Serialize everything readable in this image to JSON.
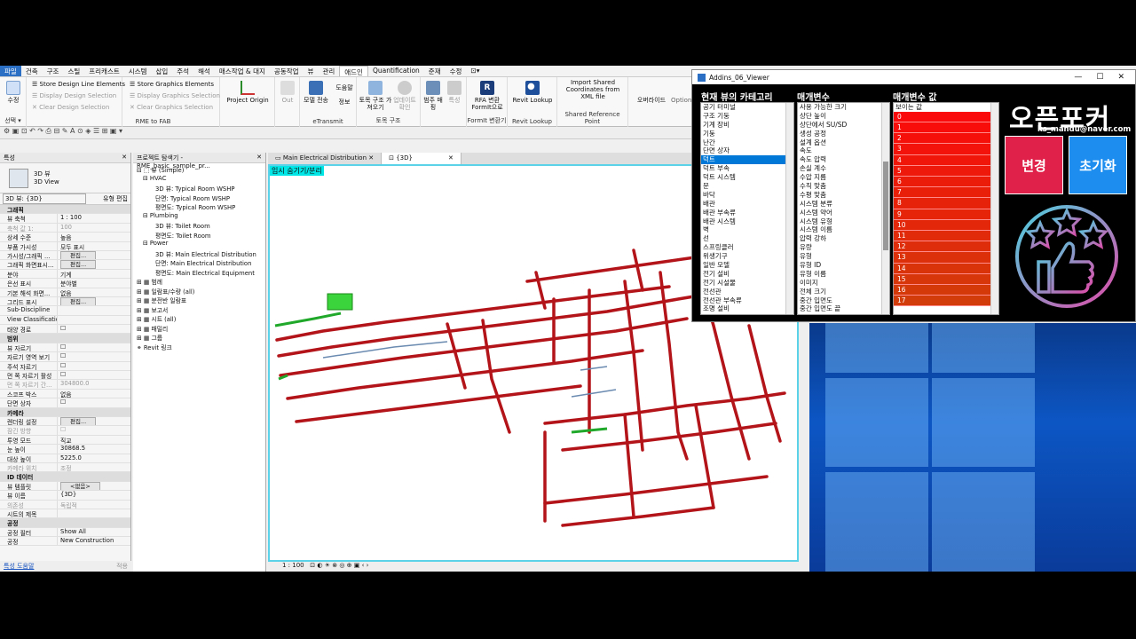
{
  "ribbon": {
    "tabs": [
      "파일",
      "건축",
      "구조",
      "스틸",
      "프리캐스트",
      "시스템",
      "삽입",
      "주석",
      "해석",
      "매스작업 & 대지",
      "공동작업",
      "뷰",
      "관리",
      "애드인",
      "Quantification",
      "준재",
      "수정",
      "⊡▾"
    ],
    "store_line": "Store Design Line Elements",
    "display_design": "Display Design Selection",
    "clear_design": "Clear Design Selection",
    "store_graphics": "Store Graphics Elements",
    "display_graphics": "Display Graphics Selection",
    "clear_graphics": "Clear Graphics Selection",
    "group_rme": "RME to FAB",
    "select_label": "선택 ▾",
    "modify": "수정",
    "project_origin": "Project Origin",
    "out": "Out",
    "model_send": "모델 전송",
    "help": "도움말",
    "info": "정보",
    "etransmit": "eTransmit",
    "civil_import": "토목 구조 가져오기",
    "update_check": "업데이트 확인",
    "range_label": "범주 매핑",
    "attr": "특성",
    "civil_group": "토목 구조",
    "rfa": "RFA 변환 FormIt으로",
    "formit_group": "FormIt 변환기",
    "revit_lookup": "Revit Lookup",
    "lookup_group": "Revit Lookup",
    "import_coords": "Import Shared Coordinates from XML file",
    "shared_ref": "Shared Reference Point",
    "override": "오버라이드",
    "option": "Option"
  },
  "properties": {
    "title": "특성",
    "type_name": "3D 뷰",
    "type_sub": "3D View",
    "selector": "3D 뷰: {3D}",
    "edit_type": "유형 편집",
    "rows": [
      {
        "k": "그래픽",
        "v": "",
        "sec": true
      },
      {
        "k": "뷰 축척",
        "v": "1 : 100"
      },
      {
        "k": "축척 값  1:",
        "v": "100",
        "dim": true
      },
      {
        "k": "상세 수준",
        "v": "높음"
      },
      {
        "k": "부품 가시성",
        "v": "모두 표시"
      },
      {
        "k": "가시성/그래픽 ...",
        "v": "편집...",
        "btn": true
      },
      {
        "k": "그래픽 화면표시...",
        "v": "편집...",
        "btn": true
      },
      {
        "k": "분야",
        "v": "기계"
      },
      {
        "k": "은선 표시",
        "v": "분야별"
      },
      {
        "k": "기본 해석 화면...",
        "v": "없음"
      },
      {
        "k": "그리드 표시",
        "v": "편집...",
        "btn": true
      },
      {
        "k": "Sub-Discipline",
        "v": ""
      },
      {
        "k": "View Classification",
        "v": ""
      },
      {
        "k": "태양 경로",
        "v": "☐"
      },
      {
        "k": "범위",
        "v": "",
        "sec": true
      },
      {
        "k": "뷰 자르기",
        "v": "☐"
      },
      {
        "k": "자르기 영역 보기",
        "v": "☐"
      },
      {
        "k": "주석 자르기",
        "v": "☐"
      },
      {
        "k": "먼 쪽 자르기 활성",
        "v": "☐"
      },
      {
        "k": "먼 쪽 자르기 간...",
        "v": "304800.0",
        "dim": true
      },
      {
        "k": "스코프 박스",
        "v": "없음"
      },
      {
        "k": "단면 상자",
        "v": "☐"
      },
      {
        "k": "카메라",
        "v": "",
        "sec": true
      },
      {
        "k": "렌더링 설정",
        "v": "편집...",
        "btn": true
      },
      {
        "k": "잠긴 방향",
        "v": "☐",
        "dim": true
      },
      {
        "k": "투영 모드",
        "v": "직교"
      },
      {
        "k": "눈 높이",
        "v": "30868.5"
      },
      {
        "k": "대상 높이",
        "v": "5225.0"
      },
      {
        "k": "카메라 위치",
        "v": "조정",
        "dim": true
      },
      {
        "k": "ID 데이터",
        "v": "",
        "sec": true
      },
      {
        "k": "뷰 템플릿",
        "v": "<없음>",
        "btn": true
      },
      {
        "k": "뷰 이름",
        "v": "{3D}"
      },
      {
        "k": "의존성",
        "v": "독립적",
        "dim": true
      },
      {
        "k": "시트의 제목",
        "v": ""
      },
      {
        "k": "공정",
        "v": "",
        "sec": true
      },
      {
        "k": "공정 필터",
        "v": "Show All"
      },
      {
        "k": "공정",
        "v": "New Construction"
      }
    ],
    "help_link": "특성 도움말",
    "apply": "적용"
  },
  "browser": {
    "title": "프로젝트 탐색기 - RME_basic_sample_pr...",
    "items": [
      {
        "t": "⊟ ⬚ 뷰 (Simple)",
        "i": 0
      },
      {
        "t": "⊟ HVAC",
        "i": 1
      },
      {
        "t": "3D 뷰: Typical Room WSHP",
        "i": 3
      },
      {
        "t": "단면: Typical Room WSHP",
        "i": 3
      },
      {
        "t": "평면도: Typical Room WSHP",
        "i": 3
      },
      {
        "t": "⊟ Plumbing",
        "i": 1
      },
      {
        "t": "3D 뷰: Toilet Room",
        "i": 3
      },
      {
        "t": "평면도: Toilet Room",
        "i": 3
      },
      {
        "t": "⊟ Power",
        "i": 1
      },
      {
        "t": "3D 뷰: Main Electrical Distribution",
        "i": 3
      },
      {
        "t": "단면: Main Electrical Distribution",
        "i": 3
      },
      {
        "t": "평면도: Main Electrical Equipment",
        "i": 3
      },
      {
        "t": "⊞ ▦ 범례",
        "i": 0
      },
      {
        "t": "⊞ ▦ 일람표/수량 (all)",
        "i": 0
      },
      {
        "t": "⊞ ▦ 분전반 일람표",
        "i": 0
      },
      {
        "t": "⊞ ▦ 보고서",
        "i": 0
      },
      {
        "t": "⊞ ▦ 시트 (all)",
        "i": 0
      },
      {
        "t": "⊞ ▦ 패밀리",
        "i": 0
      },
      {
        "t": "⊞ ▦ 그룹",
        "i": 0
      },
      {
        "t": "   ⚭ Revit 링크",
        "i": 0
      }
    ]
  },
  "view": {
    "tab1": "Main Electrical Distribution",
    "tab2": "{3D}",
    "overlay": "임시 숨기기/분리",
    "scale": "1 : 100"
  },
  "addin": {
    "title": "Addins_06_Viewer",
    "min": "—",
    "max": "☐",
    "close": "✕",
    "col1": "현재 뷰의 카테고리",
    "col2": "매개변수",
    "col3": "매개변수 값",
    "categories": [
      "공기 터미널",
      "구조 기둥",
      "기계 장비",
      "기둥",
      "난간",
      "단면 상자",
      "덕트",
      "덕트 부속",
      "덕트 시스템",
      "문",
      "바닥",
      "배관",
      "배관 부속류",
      "배관 시스템",
      "벽",
      "선",
      "스프링클러",
      "위생기구",
      "일반 모델",
      "전기 설비",
      "전기 시설물",
      "전선관",
      "전선관 부속류",
      "조명 설비"
    ],
    "selected_category": 6,
    "params": [
      "사용 가능한 크기",
      "상단 높이",
      "상단에서 SU/SD",
      "생성 공정",
      "설계 옵션",
      "속도",
      "속도 압력",
      "손실 계수",
      "수압 지름",
      "수직 맞춤",
      "수평 맞춤",
      "시스템 분류",
      "시스템 약어",
      "시스템 유형",
      "시스템 이름",
      "압력 강하",
      "유량",
      "유형",
      "유형 ID",
      "유형 이름",
      "이미지",
      "전체 크기",
      "중간 입면도",
      "중간 입면도 끝"
    ],
    "values_header": "보이는 값",
    "values": [
      "0",
      "1",
      "2",
      "3",
      "4",
      "5",
      "6",
      "7",
      "8",
      "9",
      "10",
      "11",
      "12",
      "13",
      "14",
      "15",
      "16",
      "17"
    ],
    "brand": "오픈포커스",
    "email": "ks_mandu@naver.com",
    "btn_change": "변경",
    "btn_reset": "초기화"
  }
}
